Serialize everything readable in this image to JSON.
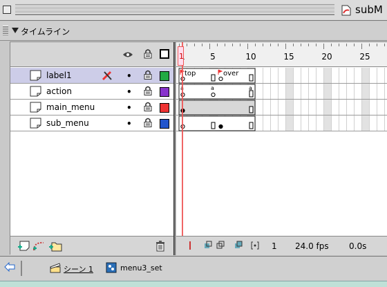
{
  "window": {
    "title": "subM"
  },
  "panel": {
    "title": "タイムライン"
  },
  "layers": [
    {
      "name": "label1",
      "selected": true,
      "has_pencil": true,
      "swatch_color": "#22aa44"
    },
    {
      "name": "action",
      "selected": false,
      "has_pencil": false,
      "swatch_color": "#8833cc"
    },
    {
      "name": "main_menu",
      "selected": false,
      "has_pencil": false,
      "swatch_color": "#ee3333"
    },
    {
      "name": "sub_menu",
      "selected": false,
      "has_pencil": false,
      "swatch_color": "#2255cc"
    }
  ],
  "ruler": {
    "labels": [
      "1",
      "5",
      "10",
      "15",
      "20",
      "25"
    ]
  },
  "frame_labels": {
    "top": "top",
    "over": "over"
  },
  "status": {
    "current_frame": "1",
    "fps": "24.0 fps",
    "time": "0.0s"
  },
  "breadcrumb": {
    "scene": "シーン 1",
    "symbol": "menu3_set"
  },
  "colors": {
    "playhead": "#ee5555",
    "selected_row": "#cdcde8",
    "stage": "#bfe0d7"
  }
}
